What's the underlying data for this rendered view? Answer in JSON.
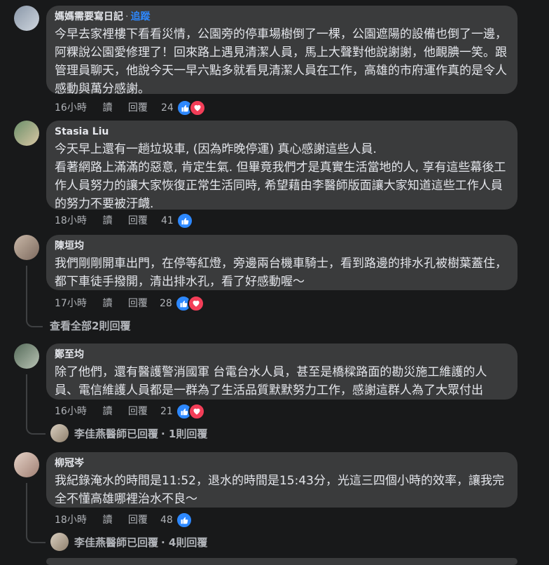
{
  "comments": [
    {
      "author": "媽媽需要寫日記",
      "dot": "·",
      "follow": "追蹤",
      "text": "今早去家裡樓下看看災情，公園旁的停車場樹倒了一棵，公園遮陽的設備也倒了一邊，阿粿說公園愛修理了！回來路上遇見清潔人員，馬上大聲對他說謝謝，他靦腆一笑。跟管理員聊天，他說今天一早六點多就看見清潔人員在工作，高雄的市府運作真的是令人感動與萬分感謝。",
      "time": "16小時",
      "read": "讀",
      "reply": "回覆",
      "reactions": "24"
    },
    {
      "author": "Stasia Liu",
      "text1": "今天早上還有一趟垃圾車, (因為昨晚停運) 真心感謝這些人員.",
      "text2": "看著網路上滿滿的惡意, 肯定生氣. 但畢竟我們才是真實生活當地的人, 享有這些幕後工作人員努力的讓大家恢復正常生活同時, 希望藉由李醫師版面讓大家知道這些工作人員的努力不要被汙衊.",
      "time": "18小時",
      "read": "讀",
      "reply": "回覆",
      "reactions": "41"
    },
    {
      "author": "陳垣均",
      "text": "我們剛剛開車出門，在停等紅燈，旁邊兩台機車騎士，看到路邊的排水孔被樹葉蓋住，都下車徒手撥開，清出排水孔，看了好感動喔～",
      "time": "17小時",
      "read": "讀",
      "reply": "回覆",
      "reactions": "28",
      "view_replies": "查看全部2則回覆"
    },
    {
      "author": "鄭至均",
      "text": "除了他們，還有醫護警消國軍 台電台水人員，甚至是橋樑路面的勘災施工維護的人員、電信維護人員都是一群為了生活品質默默努力工作，感謝這群人為了大眾付出",
      "time": "16小時",
      "read": "讀",
      "reply": "回覆",
      "reactions": "21",
      "replied": "李佳燕醫師已回覆",
      "reply_count": "· 1則回覆"
    },
    {
      "author": "柳冠岑",
      "text": "我紀錄淹水的時間是11:52，退水的時間是15:43分，光這三四個小時的效率，讓我完全不懂高雄哪裡治水不良～",
      "time": "18小時",
      "read": "讀",
      "reply": "回覆",
      "reactions": "48",
      "replied": "李佳燕醫師已回覆",
      "reply_count": "· 4則回覆"
    }
  ],
  "colors": {
    "like": "#2d88ff",
    "love": "#f33e58",
    "bubble": "#3a3b3c",
    "bg": "#18191a"
  }
}
